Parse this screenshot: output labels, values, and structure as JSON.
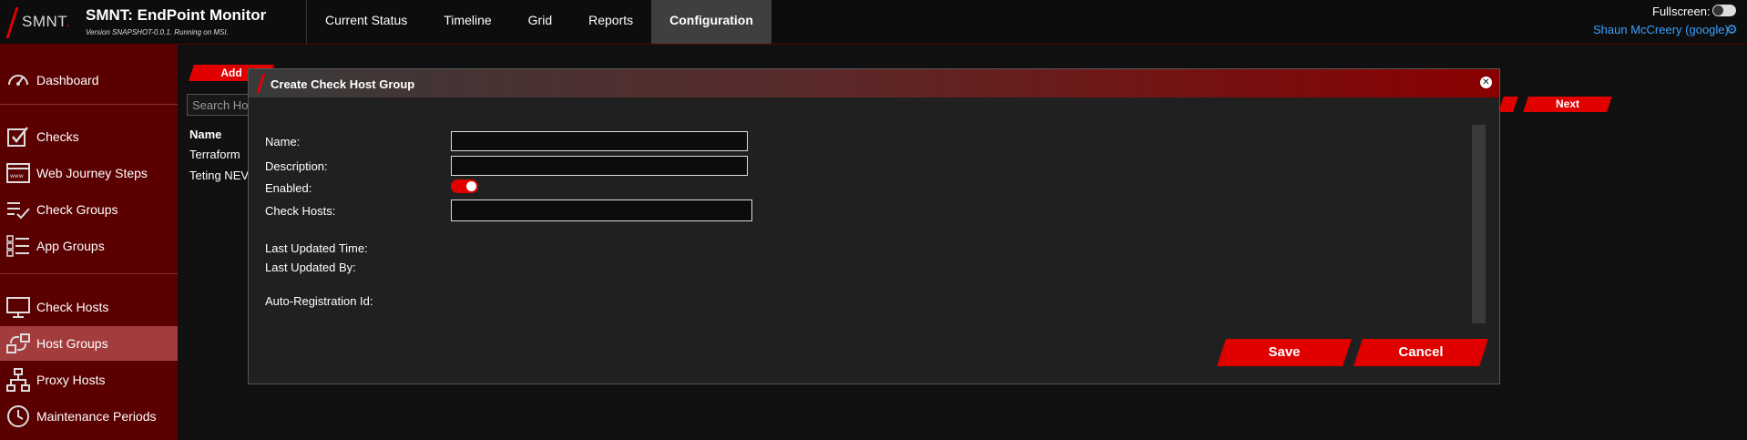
{
  "header": {
    "logo_text": "SMNT",
    "app_title": "SMNT: EndPoint Monitor",
    "app_subtitle": "Version SNAPSHOT-0.0.1. Running on MSI.",
    "tabs": [
      {
        "label": "Current Status",
        "active": false
      },
      {
        "label": "Timeline",
        "active": false
      },
      {
        "label": "Grid",
        "active": false
      },
      {
        "label": "Reports",
        "active": false
      },
      {
        "label": "Configuration",
        "active": true
      }
    ],
    "fullscreen_label": "Fullscreen:",
    "fullscreen_on": false,
    "user": "Shaun McCreery (google)",
    "gear_icon": "gear-icon"
  },
  "sidebar": {
    "items": [
      {
        "label": "Dashboard",
        "icon": "dashboard-icon",
        "active": false
      },
      {
        "label": "Checks",
        "icon": "checkbox-icon",
        "active": false
      },
      {
        "label": "Web Journey Steps",
        "icon": "browser-icon",
        "active": false
      },
      {
        "label": "Check Groups",
        "icon": "checklist-icon",
        "active": false
      },
      {
        "label": "App Groups",
        "icon": "list-icon",
        "active": false
      },
      {
        "label": "Check Hosts",
        "icon": "monitor-icon",
        "active": false
      },
      {
        "label": "Host Groups",
        "icon": "host-groups-icon",
        "active": true
      },
      {
        "label": "Proxy Hosts",
        "icon": "network-icon",
        "active": false
      },
      {
        "label": "Maintenance Periods",
        "icon": "clock-icon",
        "active": false
      }
    ]
  },
  "content": {
    "add_label": "Add",
    "search_placeholder": "Search Ho",
    "column_name": "Name",
    "rows": [
      "Terraform",
      "Teting NEV"
    ],
    "next_label": "Next"
  },
  "modal": {
    "title": "Create Check Host Group",
    "fields": {
      "name_label": "Name:",
      "name_value": "",
      "description_label": "Description:",
      "description_value": "",
      "enabled_label": "Enabled:",
      "enabled": true,
      "check_hosts_label": "Check Hosts:",
      "check_hosts_value": "",
      "last_updated_time_label": "Last Updated Time:",
      "last_updated_by_label": "Last Updated By:",
      "auto_registration_label": "Auto-Registration Id:"
    },
    "save_label": "Save",
    "cancel_label": "Cancel"
  },
  "colors": {
    "accent_red": "#e00000",
    "sidebar_bg": "#5a0000",
    "sidebar_active": "#a33c3c",
    "link_blue": "#3aa0ff"
  }
}
